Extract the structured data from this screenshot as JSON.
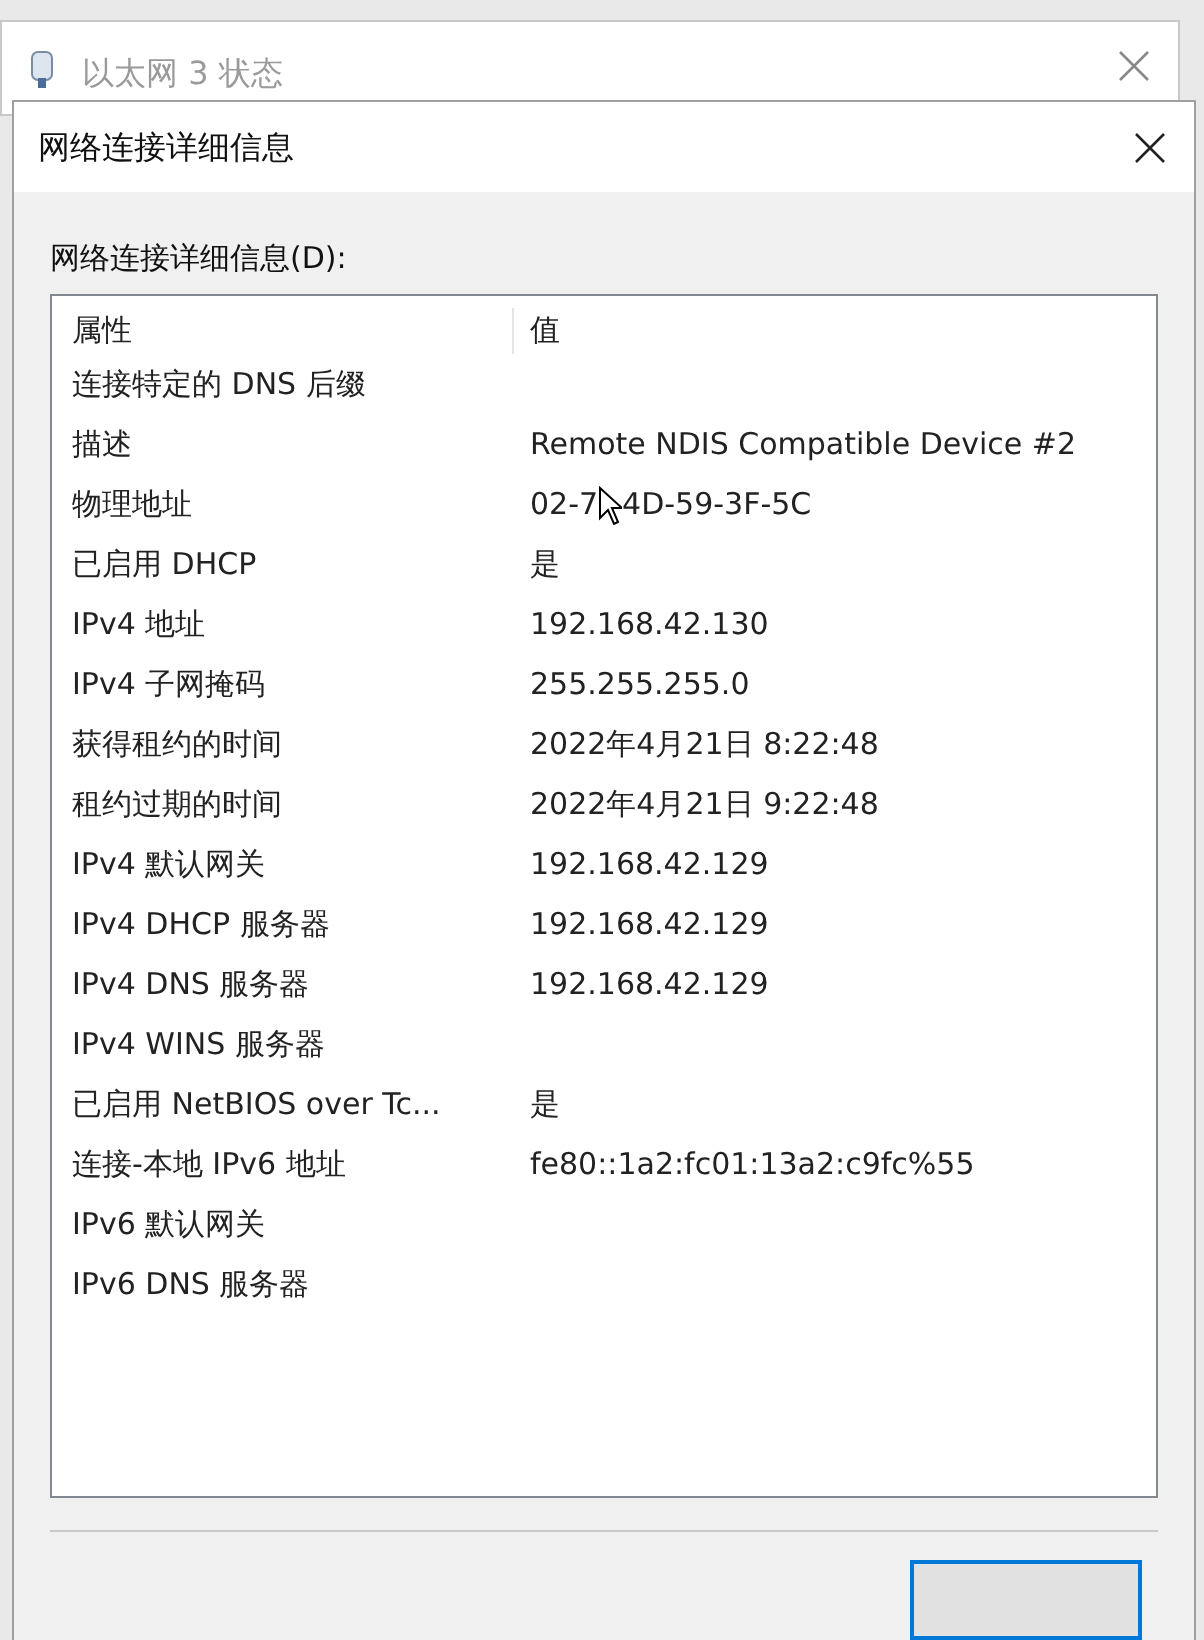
{
  "background_window": {
    "title": "以太网 3 状态"
  },
  "dialog": {
    "title": "网络连接详细信息",
    "list_label": "网络连接详细信息(D):"
  },
  "table": {
    "columns": [
      "属性",
      "值"
    ],
    "rows": [
      {
        "property": "连接特定的 DNS 后缀",
        "value": ""
      },
      {
        "property": "描述",
        "value": "Remote NDIS Compatible Device #2"
      },
      {
        "property": "物理地址",
        "value": "02-7",
        "value_after_cursor": "4D-59-3F-5C",
        "cursor": true
      },
      {
        "property": "已启用 DHCP",
        "value": "是"
      },
      {
        "property": "IPv4 地址",
        "value": "192.168.42.130"
      },
      {
        "property": "IPv4 子网掩码",
        "value": "255.255.255.0"
      },
      {
        "property": "获得租约的时间",
        "value": "2022年4月21日 8:22:48"
      },
      {
        "property": "租约过期的时间",
        "value": "2022年4月21日 9:22:48"
      },
      {
        "property": "IPv4 默认网关",
        "value": "192.168.42.129"
      },
      {
        "property": "IPv4 DHCP 服务器",
        "value": "192.168.42.129"
      },
      {
        "property": "IPv4 DNS 服务器",
        "value": "192.168.42.129"
      },
      {
        "property": "IPv4 WINS 服务器",
        "value": ""
      },
      {
        "property": "已启用 NetBIOS over Tc...",
        "value": "是"
      },
      {
        "property": "连接-本地 IPv6 地址",
        "value": "fe80::1a2:fc01:13a2:c9fc%55"
      },
      {
        "property": "IPv6 默认网关",
        "value": ""
      },
      {
        "property": "IPv6 DNS 服务器",
        "value": ""
      }
    ]
  },
  "footer_button": {
    "default": true
  }
}
